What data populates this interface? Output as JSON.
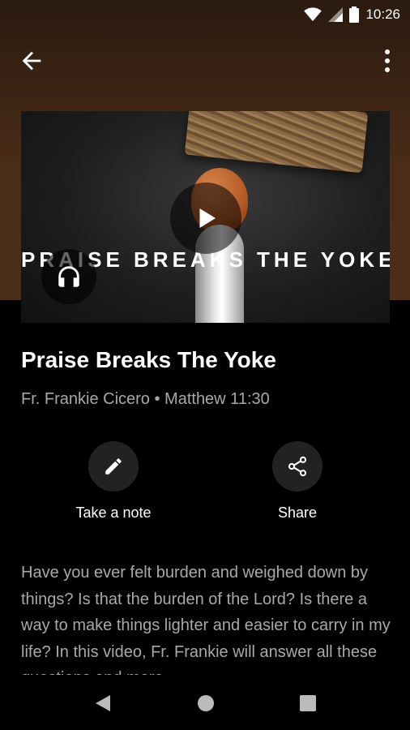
{
  "status_bar": {
    "time": "10:26",
    "icons": [
      "wifi-icon",
      "signal-icon",
      "battery-icon"
    ]
  },
  "app_bar": {
    "back_icon": "arrow-left-icon",
    "menu_icon": "more-vertical-icon"
  },
  "hero": {
    "overlay_text": "PRAISE BREAKS THE YOKE",
    "play_icon": "play-icon",
    "audio_icon": "headphones-icon"
  },
  "sermon": {
    "title": "Praise Breaks The Yoke",
    "subtitle": "Fr. Frankie Cicero • Matthew 11:30",
    "description": "Have you ever felt burden and weighed down by things? Is that the burden of the Lord? Is there a way to make things lighter and easier to carry in my life? In this video, Fr. Frankie will answer all these questions and more."
  },
  "actions": {
    "note_label": "Take a note",
    "share_label": "Share"
  },
  "nav_bar": {
    "icons": [
      "nav-back-icon",
      "nav-home-icon",
      "nav-recents-icon"
    ]
  },
  "colors": {
    "header_brown": "#4a2c17",
    "background": "#000000",
    "secondary_text": "#a8a8a8"
  }
}
